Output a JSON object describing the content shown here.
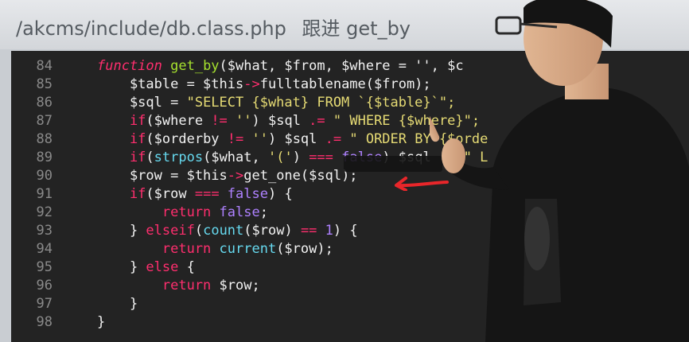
{
  "title": {
    "path": "/akcms/include/db.class.php",
    "note": "跟进 get_by"
  },
  "subtitle_overlay": "",
  "code": {
    "lines": [
      {
        "n": "84",
        "tokens": [
          [
            "fn",
            "function "
          ],
          [
            "fnname",
            "get_by"
          ],
          [
            "var",
            "($what, $from, $where = '', $c"
          ]
        ]
      },
      {
        "n": "85",
        "tokens": [
          [
            "var",
            "    $table = $this"
          ],
          [
            "op",
            "->"
          ],
          [
            "var",
            "fulltablename($from);"
          ]
        ]
      },
      {
        "n": "86",
        "tokens": [
          [
            "var",
            "    $sql = "
          ],
          [
            "str",
            "\"SELECT {$what} FROM `{$table}`\";"
          ]
        ]
      },
      {
        "n": "87",
        "tokens": [
          [
            "kw",
            "    if"
          ],
          [
            "var",
            "($where "
          ],
          [
            "op",
            "!="
          ],
          [
            "str",
            " ''"
          ],
          [
            "var",
            ") $sql "
          ],
          [
            "op",
            ".="
          ],
          [
            "str",
            " \" WHERE {$where}\";"
          ]
        ]
      },
      {
        "n": "88",
        "tokens": [
          [
            "kw",
            "    if"
          ],
          [
            "var",
            "($orderby "
          ],
          [
            "op",
            "!="
          ],
          [
            "str",
            " ''"
          ],
          [
            "var",
            ") $sql "
          ],
          [
            "op",
            ".="
          ],
          [
            "str",
            " \" ORDER BY {$orde"
          ]
        ]
      },
      {
        "n": "89",
        "tokens": [
          [
            "kw",
            "    if"
          ],
          [
            "var",
            "("
          ],
          [
            "call",
            "strpos"
          ],
          [
            "var",
            "($what, "
          ],
          [
            "str",
            "'('"
          ],
          [
            "var",
            ") "
          ],
          [
            "op",
            "==="
          ],
          [
            "num",
            " false"
          ],
          [
            "var",
            ") $sql "
          ],
          [
            "op",
            ".="
          ],
          [
            "str",
            " \" L"
          ]
        ]
      },
      {
        "n": "90",
        "tokens": [
          [
            "var",
            "    $row = $this"
          ],
          [
            "op",
            "->"
          ],
          [
            "var",
            "get_one($sql);"
          ]
        ]
      },
      {
        "n": "91",
        "tokens": [
          [
            "kw",
            "    if"
          ],
          [
            "var",
            "($row "
          ],
          [
            "op",
            "==="
          ],
          [
            "num",
            " false"
          ],
          [
            "var",
            ") {"
          ]
        ]
      },
      {
        "n": "92",
        "tokens": [
          [
            "kw",
            "        return "
          ],
          [
            "num",
            "false"
          ],
          [
            "var",
            ";"
          ]
        ]
      },
      {
        "n": "93",
        "tokens": [
          [
            "var",
            "    } "
          ],
          [
            "kw",
            "elseif"
          ],
          [
            "var",
            "("
          ],
          [
            "call",
            "count"
          ],
          [
            "var",
            "($row) "
          ],
          [
            "op",
            "=="
          ],
          [
            "num",
            " 1"
          ],
          [
            "var",
            ") {"
          ]
        ]
      },
      {
        "n": "94",
        "tokens": [
          [
            "kw",
            "        return "
          ],
          [
            "call",
            "current"
          ],
          [
            "var",
            "($row);"
          ]
        ]
      },
      {
        "n": "95",
        "tokens": [
          [
            "var",
            "    } "
          ],
          [
            "kw",
            "else"
          ],
          [
            "var",
            " {"
          ]
        ]
      },
      {
        "n": "96",
        "tokens": [
          [
            "kw",
            "        return "
          ],
          [
            "var",
            "$row;"
          ]
        ]
      },
      {
        "n": "97",
        "tokens": [
          [
            "var",
            "    }"
          ]
        ]
      },
      {
        "n": "98",
        "tokens": [
          [
            "var",
            "}"
          ]
        ]
      }
    ]
  },
  "colors": {
    "editor_bg": "#232323",
    "keyword": "#ff2e6e",
    "string": "#e6db74",
    "constant": "#ae81ff",
    "function_name": "#a6e22e",
    "builtin": "#66d9ef",
    "arrow": "#e8262a"
  }
}
